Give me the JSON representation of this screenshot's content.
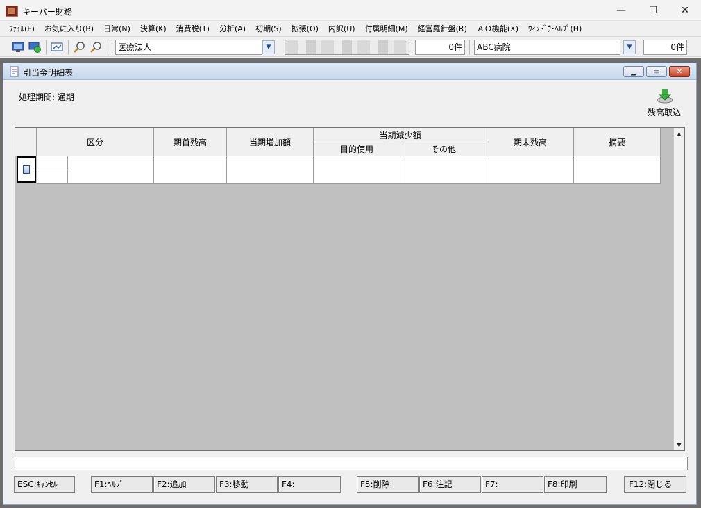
{
  "window": {
    "title": "キーパー財務",
    "controls": {
      "minimize": "—",
      "maximize": "☐",
      "close": "✕"
    }
  },
  "menu": [
    "ﾌｧｲﾙ(F)",
    "お気に入り(B)",
    "日常(N)",
    "決算(K)",
    "消費税(T)",
    "分析(A)",
    "初期(S)",
    "拡張(O)",
    "内訳(U)",
    "付属明細(M)",
    "経営羅針盤(R)",
    "ＡＯ機能(X)",
    "ｳｨﾝﾄﾞｳ･ﾍﾙﾌﾟ(H)"
  ],
  "toolbar": {
    "entity_type": "医療法人",
    "count1": "0件",
    "hospital": "ABC病院",
    "count2": "0件"
  },
  "subwindow": {
    "title": "引当金明細表",
    "period": "処理期間: 通期",
    "import_label": "残高取込"
  },
  "table": {
    "headers": {
      "category": "区分",
      "opening_balance": "期首残高",
      "increase": "当期増加額",
      "decrease_group": "当期減少額",
      "decrease_purpose": "目的使用",
      "decrease_other": "その他",
      "closing_balance": "期末残高",
      "remarks": "摘要"
    }
  },
  "fkeys": {
    "esc": "ESC:ｷｬﾝｾﾙ",
    "f1": "F1:ﾍﾙﾌﾟ",
    "f2": "F2:追加",
    "f3": "F3:移動",
    "f4": "F4:",
    "f5": "F5:削除",
    "f6": "F6:注記",
    "f7": "F7:",
    "f8": "F8:印刷",
    "f12": "F12:閉じる"
  }
}
